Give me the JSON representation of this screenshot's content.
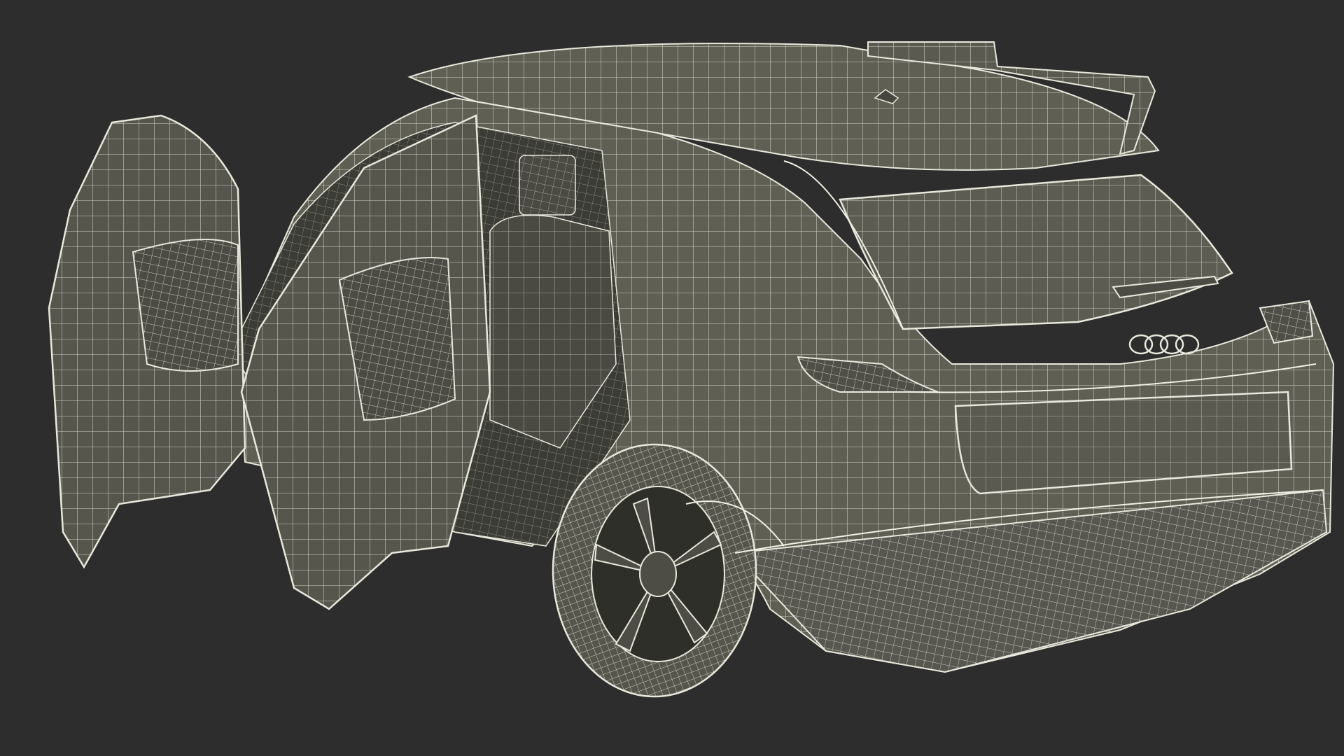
{
  "scene": {
    "background_color": "#2d2d2d",
    "model_fill_color": "#5f5f54",
    "model_shadow_color": "#45453d",
    "wireframe_color": "#e8e8dc"
  }
}
